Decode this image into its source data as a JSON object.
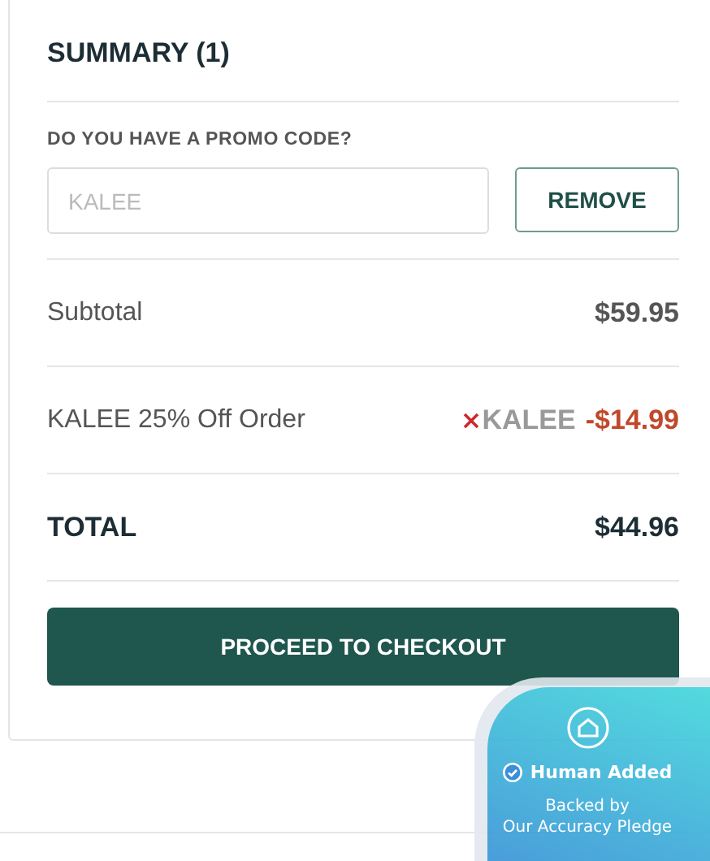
{
  "summary": {
    "title": "SUMMARY (1)"
  },
  "promo": {
    "label": "DO YOU HAVE A PROMO CODE?",
    "value": "KALEE",
    "disabled": true,
    "button": "REMOVE"
  },
  "lines": [
    {
      "kind": "subtotal",
      "label": "Subtotal",
      "amount": "$59.95"
    },
    {
      "kind": "discount",
      "label": "KALEE 25% Off Order",
      "code": "KALEE",
      "amount": "-$14.99"
    },
    {
      "kind": "total",
      "label": "TOTAL",
      "amount": "$44.96"
    }
  ],
  "checkout_button": "PROCEED TO CHECKOUT",
  "badge": {
    "title": "Human Added",
    "lines": [
      "Backed by",
      "Our Accuracy Pledge"
    ]
  }
}
